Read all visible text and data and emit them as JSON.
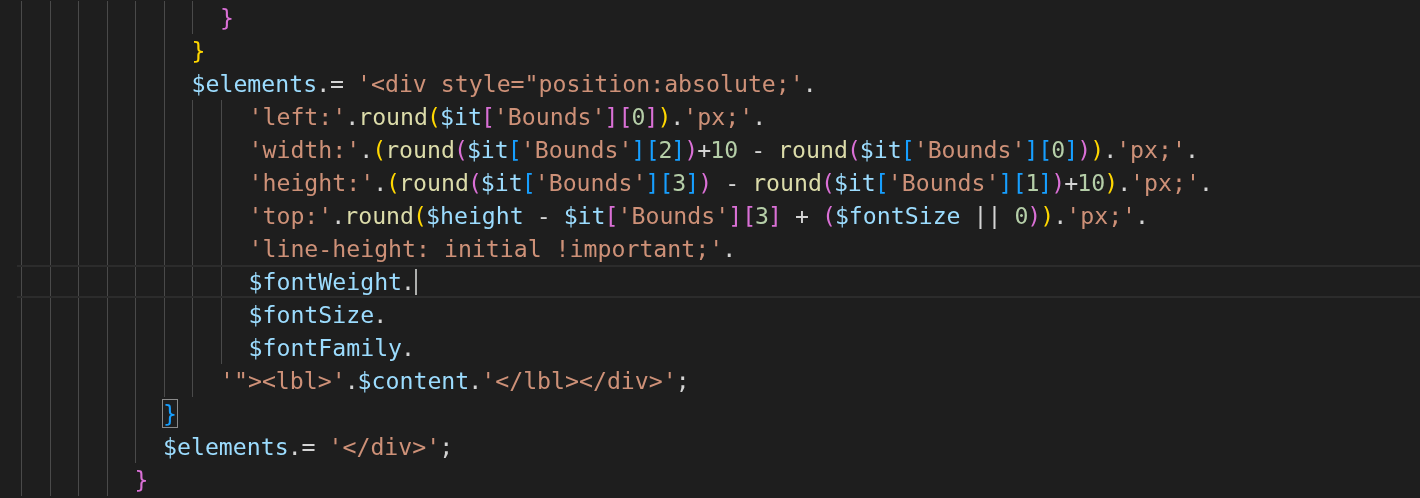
{
  "editor": {
    "items": [
      {
        "kind": "block",
        "children": [
          {
            "kind": "block",
            "children": [
              {
                "kind": "block",
                "children": [
                  {
                    "kind": "block",
                    "children": [
                      {
                        "kind": "block",
                        "children": [
                          {
                            "kind": "block",
                            "children": [
                              {
                                "kind": "block",
                                "children": [
                                  {
                                    "kind": "line",
                                    "current": false,
                                    "tokens": [
                                      {
                                        "kind": "bracket",
                                        "color": "#da70d6",
                                        "text": "}",
                                        "matched": false
                                      }
                                    ]
                                  }
                                ]
                              },
                              {
                                "kind": "line",
                                "current": false,
                                "tokens": [
                                  {
                                    "kind": "bracket",
                                    "color": "#ffd700",
                                    "text": "}",
                                    "matched": false
                                  }
                                ]
                              },
                              {
                                "kind": "line",
                                "current": false,
                                "tokens": [
                                  {
                                    "kind": "var",
                                    "text": "$elements"
                                  },
                                  {
                                    "kind": "op",
                                    "text": ".= "
                                  },
                                  {
                                    "kind": "str",
                                    "text": "'<div style=\"position:absolute;'"
                                  },
                                  {
                                    "kind": "op",
                                    "text": "."
                                  }
                                ]
                              },
                              {
                                "kind": "block",
                                "children": [
                                  {
                                    "kind": "block",
                                    "children": [
                                      {
                                        "kind": "line",
                                        "current": false,
                                        "tokens": [
                                          {
                                            "kind": "str",
                                            "text": "'left:'"
                                          },
                                          {
                                            "kind": "op",
                                            "text": "."
                                          },
                                          {
                                            "kind": "fn",
                                            "text": "round"
                                          },
                                          {
                                            "kind": "bracket",
                                            "color": "#ffd700",
                                            "text": "(",
                                            "matched": false
                                          },
                                          {
                                            "kind": "var",
                                            "text": "$it"
                                          },
                                          {
                                            "kind": "bracket",
                                            "color": "#da70d6",
                                            "text": "[",
                                            "matched": false
                                          },
                                          {
                                            "kind": "str",
                                            "text": "'Bounds'"
                                          },
                                          {
                                            "kind": "bracket",
                                            "color": "#da70d6",
                                            "text": "][",
                                            "matched": false
                                          },
                                          {
                                            "kind": "num",
                                            "text": "0"
                                          },
                                          {
                                            "kind": "bracket",
                                            "color": "#da70d6",
                                            "text": "]",
                                            "matched": false
                                          },
                                          {
                                            "kind": "bracket",
                                            "color": "#ffd700",
                                            "text": ")",
                                            "matched": false
                                          },
                                          {
                                            "kind": "op",
                                            "text": "."
                                          },
                                          {
                                            "kind": "str",
                                            "text": "'px;'"
                                          },
                                          {
                                            "kind": "op",
                                            "text": "."
                                          }
                                        ]
                                      },
                                      {
                                        "kind": "line",
                                        "current": false,
                                        "tokens": [
                                          {
                                            "kind": "str",
                                            "text": "'width:'"
                                          },
                                          {
                                            "kind": "op",
                                            "text": "."
                                          },
                                          {
                                            "kind": "bracket",
                                            "color": "#ffd700",
                                            "text": "(",
                                            "matched": false
                                          },
                                          {
                                            "kind": "fn",
                                            "text": "round"
                                          },
                                          {
                                            "kind": "bracket",
                                            "color": "#da70d6",
                                            "text": "(",
                                            "matched": false
                                          },
                                          {
                                            "kind": "var",
                                            "text": "$it"
                                          },
                                          {
                                            "kind": "bracket",
                                            "color": "#179fff",
                                            "text": "[",
                                            "matched": false
                                          },
                                          {
                                            "kind": "str",
                                            "text": "'Bounds'"
                                          },
                                          {
                                            "kind": "bracket",
                                            "color": "#179fff",
                                            "text": "][",
                                            "matched": false
                                          },
                                          {
                                            "kind": "num",
                                            "text": "2"
                                          },
                                          {
                                            "kind": "bracket",
                                            "color": "#179fff",
                                            "text": "]",
                                            "matched": false
                                          },
                                          {
                                            "kind": "bracket",
                                            "color": "#da70d6",
                                            "text": ")",
                                            "matched": false
                                          },
                                          {
                                            "kind": "op",
                                            "text": "+"
                                          },
                                          {
                                            "kind": "num",
                                            "text": "10"
                                          },
                                          {
                                            "kind": "op",
                                            "text": " - "
                                          },
                                          {
                                            "kind": "fn",
                                            "text": "round"
                                          },
                                          {
                                            "kind": "bracket",
                                            "color": "#da70d6",
                                            "text": "(",
                                            "matched": false
                                          },
                                          {
                                            "kind": "var",
                                            "text": "$it"
                                          },
                                          {
                                            "kind": "bracket",
                                            "color": "#179fff",
                                            "text": "[",
                                            "matched": false
                                          },
                                          {
                                            "kind": "str",
                                            "text": "'Bounds'"
                                          },
                                          {
                                            "kind": "bracket",
                                            "color": "#179fff",
                                            "text": "][",
                                            "matched": false
                                          },
                                          {
                                            "kind": "num",
                                            "text": "0"
                                          },
                                          {
                                            "kind": "bracket",
                                            "color": "#179fff",
                                            "text": "]",
                                            "matched": false
                                          },
                                          {
                                            "kind": "bracket",
                                            "color": "#da70d6",
                                            "text": ")",
                                            "matched": false
                                          },
                                          {
                                            "kind": "bracket",
                                            "color": "#ffd700",
                                            "text": ")",
                                            "matched": false
                                          },
                                          {
                                            "kind": "op",
                                            "text": "."
                                          },
                                          {
                                            "kind": "str",
                                            "text": "'px;'"
                                          },
                                          {
                                            "kind": "op",
                                            "text": "."
                                          }
                                        ]
                                      },
                                      {
                                        "kind": "line",
                                        "current": false,
                                        "tokens": [
                                          {
                                            "kind": "str",
                                            "text": "'height:'"
                                          },
                                          {
                                            "kind": "op",
                                            "text": "."
                                          },
                                          {
                                            "kind": "bracket",
                                            "color": "#ffd700",
                                            "text": "(",
                                            "matched": false
                                          },
                                          {
                                            "kind": "fn",
                                            "text": "round"
                                          },
                                          {
                                            "kind": "bracket",
                                            "color": "#da70d6",
                                            "text": "(",
                                            "matched": false
                                          },
                                          {
                                            "kind": "var",
                                            "text": "$it"
                                          },
                                          {
                                            "kind": "bracket",
                                            "color": "#179fff",
                                            "text": "[",
                                            "matched": false
                                          },
                                          {
                                            "kind": "str",
                                            "text": "'Bounds'"
                                          },
                                          {
                                            "kind": "bracket",
                                            "color": "#179fff",
                                            "text": "][",
                                            "matched": false
                                          },
                                          {
                                            "kind": "num",
                                            "text": "3"
                                          },
                                          {
                                            "kind": "bracket",
                                            "color": "#179fff",
                                            "text": "]",
                                            "matched": false
                                          },
                                          {
                                            "kind": "bracket",
                                            "color": "#da70d6",
                                            "text": ")",
                                            "matched": false
                                          },
                                          {
                                            "kind": "op",
                                            "text": " - "
                                          },
                                          {
                                            "kind": "fn",
                                            "text": "round"
                                          },
                                          {
                                            "kind": "bracket",
                                            "color": "#da70d6",
                                            "text": "(",
                                            "matched": false
                                          },
                                          {
                                            "kind": "var",
                                            "text": "$it"
                                          },
                                          {
                                            "kind": "bracket",
                                            "color": "#179fff",
                                            "text": "[",
                                            "matched": false
                                          },
                                          {
                                            "kind": "str",
                                            "text": "'Bounds'"
                                          },
                                          {
                                            "kind": "bracket",
                                            "color": "#179fff",
                                            "text": "][",
                                            "matched": false
                                          },
                                          {
                                            "kind": "num",
                                            "text": "1"
                                          },
                                          {
                                            "kind": "bracket",
                                            "color": "#179fff",
                                            "text": "]",
                                            "matched": false
                                          },
                                          {
                                            "kind": "bracket",
                                            "color": "#da70d6",
                                            "text": ")",
                                            "matched": false
                                          },
                                          {
                                            "kind": "op",
                                            "text": "+"
                                          },
                                          {
                                            "kind": "num",
                                            "text": "10"
                                          },
                                          {
                                            "kind": "bracket",
                                            "color": "#ffd700",
                                            "text": ")",
                                            "matched": false
                                          },
                                          {
                                            "kind": "op",
                                            "text": "."
                                          },
                                          {
                                            "kind": "str",
                                            "text": "'px;'"
                                          },
                                          {
                                            "kind": "op",
                                            "text": "."
                                          }
                                        ]
                                      },
                                      {
                                        "kind": "line",
                                        "current": false,
                                        "tokens": [
                                          {
                                            "kind": "str",
                                            "text": "'top:'"
                                          },
                                          {
                                            "kind": "op",
                                            "text": "."
                                          },
                                          {
                                            "kind": "fn",
                                            "text": "round"
                                          },
                                          {
                                            "kind": "bracket",
                                            "color": "#ffd700",
                                            "text": "(",
                                            "matched": false
                                          },
                                          {
                                            "kind": "var",
                                            "text": "$height"
                                          },
                                          {
                                            "kind": "op",
                                            "text": " - "
                                          },
                                          {
                                            "kind": "var",
                                            "text": "$it"
                                          },
                                          {
                                            "kind": "bracket",
                                            "color": "#da70d6",
                                            "text": "[",
                                            "matched": false
                                          },
                                          {
                                            "kind": "str",
                                            "text": "'Bounds'"
                                          },
                                          {
                                            "kind": "bracket",
                                            "color": "#da70d6",
                                            "text": "][",
                                            "matched": false
                                          },
                                          {
                                            "kind": "num",
                                            "text": "3"
                                          },
                                          {
                                            "kind": "bracket",
                                            "color": "#da70d6",
                                            "text": "]",
                                            "matched": false
                                          },
                                          {
                                            "kind": "op",
                                            "text": " + "
                                          },
                                          {
                                            "kind": "bracket",
                                            "color": "#da70d6",
                                            "text": "(",
                                            "matched": false
                                          },
                                          {
                                            "kind": "var",
                                            "text": "$fontSize"
                                          },
                                          {
                                            "kind": "op",
                                            "text": " || "
                                          },
                                          {
                                            "kind": "num",
                                            "text": "0"
                                          },
                                          {
                                            "kind": "bracket",
                                            "color": "#da70d6",
                                            "text": ")",
                                            "matched": false
                                          },
                                          {
                                            "kind": "bracket",
                                            "color": "#ffd700",
                                            "text": ")",
                                            "matched": false
                                          },
                                          {
                                            "kind": "op",
                                            "text": "."
                                          },
                                          {
                                            "kind": "str",
                                            "text": "'px;'"
                                          },
                                          {
                                            "kind": "op",
                                            "text": "."
                                          }
                                        ]
                                      },
                                      {
                                        "kind": "line",
                                        "current": false,
                                        "tokens": [
                                          {
                                            "kind": "str",
                                            "text": "'line-height: initial !important;'"
                                          },
                                          {
                                            "kind": "op",
                                            "text": "."
                                          }
                                        ]
                                      },
                                      {
                                        "kind": "line",
                                        "current": true,
                                        "tokens": [
                                          {
                                            "kind": "var",
                                            "text": "$fontWeight"
                                          },
                                          {
                                            "kind": "op",
                                            "text": "."
                                          }
                                        ]
                                      },
                                      {
                                        "kind": "line",
                                        "current": false,
                                        "tokens": [
                                          {
                                            "kind": "var",
                                            "text": "$fontSize"
                                          },
                                          {
                                            "kind": "op",
                                            "text": "."
                                          }
                                        ]
                                      },
                                      {
                                        "kind": "line",
                                        "current": false,
                                        "tokens": [
                                          {
                                            "kind": "var",
                                            "text": "$fontFamily"
                                          },
                                          {
                                            "kind": "op",
                                            "text": "."
                                          }
                                        ]
                                      }
                                    ]
                                  },
                                  {
                                    "kind": "line",
                                    "current": false,
                                    "tokens": [
                                      {
                                        "kind": "str",
                                        "text": "'\"><lbl>'"
                                      },
                                      {
                                        "kind": "op",
                                        "text": "."
                                      },
                                      {
                                        "kind": "var",
                                        "text": "$content"
                                      },
                                      {
                                        "kind": "op",
                                        "text": "."
                                      },
                                      {
                                        "kind": "str",
                                        "text": "'</lbl></div>'"
                                      },
                                      {
                                        "kind": "op",
                                        "text": ";"
                                      }
                                    ]
                                  }
                                ]
                              }
                            ]
                          },
                          {
                            "kind": "line",
                            "current": false,
                            "tokens": [
                              {
                                "kind": "bracket",
                                "color": "#179fff",
                                "text": "}",
                                "matched": true
                              }
                            ]
                          },
                          {
                            "kind": "line",
                            "current": false,
                            "tokens": [
                              {
                                "kind": "var",
                                "text": "$elements"
                              },
                              {
                                "kind": "op",
                                "text": ".= "
                              },
                              {
                                "kind": "str",
                                "text": "'</div>'"
                              },
                              {
                                "kind": "op",
                                "text": ";"
                              }
                            ]
                          }
                        ]
                      },
                      {
                        "kind": "line",
                        "current": false,
                        "tokens": [
                          {
                            "kind": "bracket",
                            "color": "#da70d6",
                            "text": "}",
                            "matched": false
                          }
                        ]
                      }
                    ]
                  }
                ]
              }
            ]
          }
        ]
      }
    ]
  }
}
